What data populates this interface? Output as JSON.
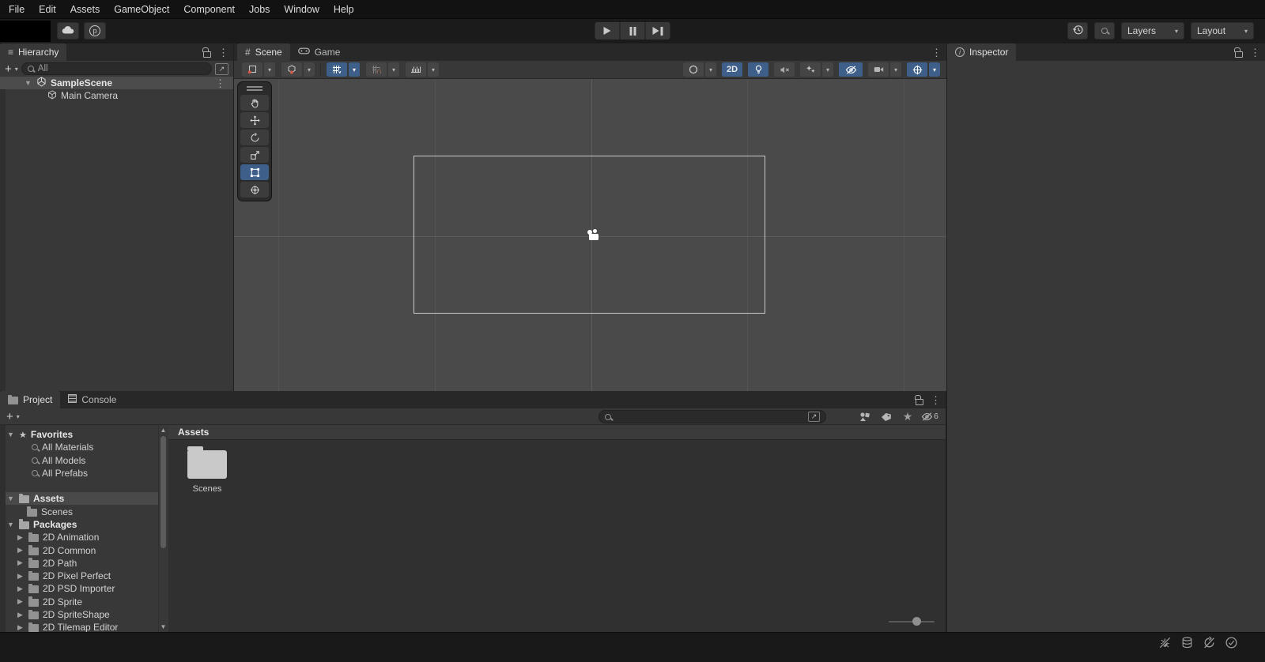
{
  "colors": {
    "selection_blue": "#3e5f8a",
    "panel_gray": "#383838",
    "scene_background": "#4a4a4a",
    "tab_bar": "#282828",
    "status_bar": "#191919"
  },
  "icons": {
    "kebab": "⋮",
    "hierarchy_glyph": "≡",
    "hash": "#",
    "foldout_open": "▼",
    "foldout_closed": "▶",
    "dropdown": "▾",
    "plus": "+",
    "star": "★",
    "info": "i",
    "open_in_window": "↗",
    "scroll_up": "▲",
    "scroll_down": "▼",
    "version_control": "p",
    "play_icon": "▶",
    "pause_icon": "▮▮",
    "step_icon": "▶▮"
  },
  "menu_bar": {
    "items": [
      "File",
      "Edit",
      "Assets",
      "GameObject",
      "Component",
      "Jobs",
      "Window",
      "Help"
    ]
  },
  "toolbar": {
    "layers_dropdown": "Layers",
    "layout_dropdown": "Layout"
  },
  "hierarchy": {
    "tab_label": "Hierarchy",
    "search_value": "All",
    "scene_row": {
      "label": "SampleScene"
    },
    "child_rows": [
      {
        "label": "Main Camera"
      }
    ]
  },
  "scene_view": {
    "scene_tab": "Scene",
    "game_tab": "Game",
    "toggle_2d": "2D"
  },
  "inspector": {
    "tab_label": "Inspector"
  },
  "project": {
    "project_tab": "Project",
    "console_tab": "Console",
    "breadcrumb": "Assets",
    "hidden_count": "6",
    "tree": {
      "favorites_label": "Favorites",
      "favorites_items": [
        "All Materials",
        "All Models",
        "All Prefabs"
      ],
      "assets_label": "Assets",
      "assets_children": [
        "Scenes"
      ],
      "packages_label": "Packages",
      "packages_items": [
        "2D Animation",
        "2D Common",
        "2D Path",
        "2D Pixel Perfect",
        "2D PSD Importer",
        "2D Sprite",
        "2D SpriteShape",
        "2D Tilemap Editor"
      ]
    },
    "content_items": [
      {
        "label": "Scenes"
      }
    ]
  }
}
